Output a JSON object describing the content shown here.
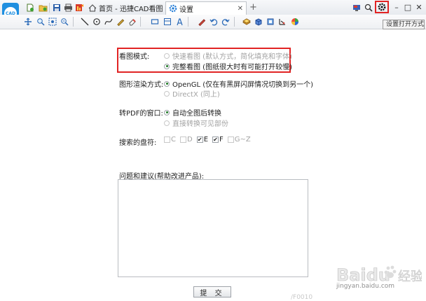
{
  "app": {
    "logo_text": "CAD",
    "tabs": [
      {
        "label": "首页 - 迅捷CAD看图",
        "active": false
      },
      {
        "label": "设置",
        "active": true
      }
    ],
    "tab_close": "✕",
    "new_tab": "+",
    "window_controls": [
      "–",
      "□",
      "✕"
    ],
    "settings_tooltip": "设置打开方式。"
  },
  "settings": {
    "view_mode": {
      "label": "看图模式:",
      "options": [
        {
          "label": "快速看图 (默认方式，简化填充和字体)",
          "selected": false,
          "enabled": false
        },
        {
          "label": "完整看图 (图纸很大时有可能打开较慢)",
          "selected": true,
          "enabled": true
        }
      ]
    },
    "render_mode": {
      "label": "图形渲染方式:",
      "options": [
        {
          "label": "OpenGL (仅在有黑屏闪屏情况切换到另一个)",
          "selected": true,
          "enabled": true
        },
        {
          "label": "DirectX  (同上)",
          "selected": false,
          "enabled": false
        }
      ]
    },
    "pdf_window": {
      "label": "转PDF的窗口:",
      "options": [
        {
          "label": "自动全图后转换",
          "selected": true,
          "enabled": true
        },
        {
          "label": "直接转换可见部份",
          "selected": false,
          "enabled": false
        }
      ]
    },
    "search_drives": {
      "label": "搜索的盘符:",
      "drives": [
        {
          "label": "C",
          "checked": false,
          "enabled": false
        },
        {
          "label": "D",
          "checked": false,
          "enabled": false
        },
        {
          "label": "E",
          "checked": true,
          "enabled": true
        },
        {
          "label": "F",
          "checked": true,
          "enabled": true
        },
        {
          "label": "G~Z",
          "checked": false,
          "enabled": false
        }
      ]
    },
    "feedback": {
      "label": "问题和建议(帮助改进产品):",
      "value": ""
    },
    "submit_label": "提 交"
  },
  "watermark": {
    "brand": "Baidu",
    "brand_suffix": "经验",
    "url": "jingyan.baidu.com",
    "bottom_text": "/F0010"
  },
  "colors": {
    "highlight": "#e12424",
    "accent": "#1f8fe0",
    "radio_dot": "#1e7a24"
  }
}
